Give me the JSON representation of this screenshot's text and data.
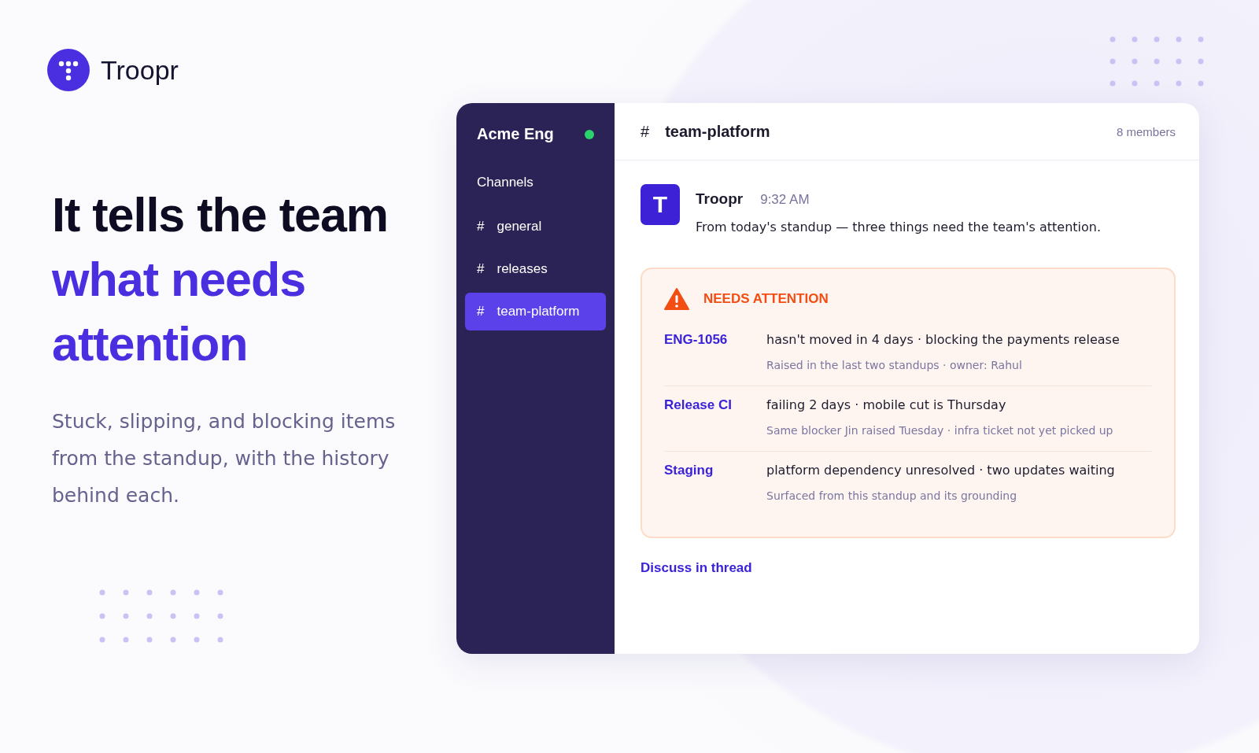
{
  "brand": {
    "name": "Troopr"
  },
  "hero": {
    "headline": "It tells the team",
    "highlight": "what needs attention",
    "subtext": "Stuck, slipping, and blocking items from the standup, with the history behind each."
  },
  "sidebar": {
    "workspace": "Acme Eng",
    "online": true,
    "section": "Channels",
    "items": [
      {
        "hash": "#",
        "label": "general",
        "selected": false
      },
      {
        "hash": "#",
        "label": "releases",
        "selected": false
      },
      {
        "hash": "#",
        "label": "team-platform",
        "selected": true
      }
    ]
  },
  "channel": {
    "hash": "#",
    "name": "team-platform",
    "members": "8 members"
  },
  "message": {
    "avatar": "T",
    "author": "Troopr",
    "time": "9:32 AM",
    "text": "From today's standup — three things need the team's attention."
  },
  "attention": {
    "title": "NEEDS ATTENTION",
    "items": [
      {
        "key": "ENG-1056",
        "detail": "hasn't moved in 4 days · blocking the payments release",
        "history": "Raised in the last two standups · owner: Rahul"
      },
      {
        "key": "Release CI",
        "detail": "failing 2 days · mobile cut is Thursday",
        "history": "Same blocker Jin raised Tuesday · infra ticket not yet picked up"
      },
      {
        "key": "Staging",
        "detail": "platform dependency unresolved · two updates waiting",
        "history": "Surfaced from this standup and its grounding"
      }
    ]
  },
  "thread_link": "Discuss in thread"
}
